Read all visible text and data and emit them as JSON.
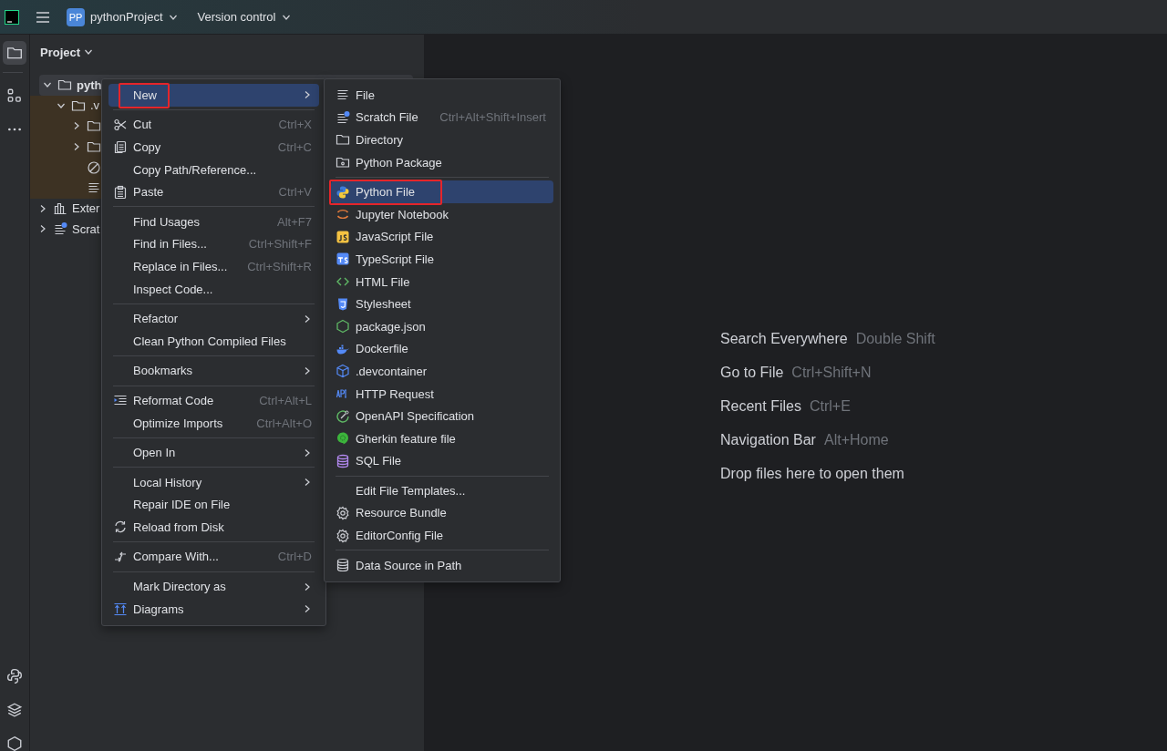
{
  "top_bar": {
    "project_badge": "PP",
    "project_name": "pythonProject",
    "vcs": "Version control"
  },
  "tool_strip": {
    "top": [
      {
        "selected": true
      },
      {
        "selected": false
      },
      {
        "selected": false
      }
    ],
    "bottom": [
      {
        "selected": false
      },
      {
        "selected": false
      },
      {
        "selected": false
      }
    ]
  },
  "project_panel": {
    "title": "Project",
    "tree": [
      {
        "kind": "folder",
        "label": "pyth",
        "expanded": true,
        "selected": true,
        "excluded": false,
        "children": [
          {
            "kind": "folder",
            "label": ".v",
            "expanded": true,
            "selected": false,
            "excluded": true,
            "children": [
              {
                "kind": "folder",
                "expanded": false,
                "selected": false,
                "excluded": true
              },
              {
                "kind": "folder",
                "expanded": false,
                "selected": false,
                "excluded": true
              },
              {
                "kind": "ignored",
                "selected": false,
                "excluded": true
              },
              {
                "kind": "text",
                "selected": false,
                "excluded": true
              }
            ]
          }
        ]
      },
      {
        "kind": "library",
        "label": "Exter",
        "expanded": false,
        "selected": false,
        "excluded": false
      },
      {
        "kind": "scratch",
        "label": "Scrat",
        "expanded": false,
        "selected": false,
        "excluded": false
      }
    ]
  },
  "context_menu": {
    "items": [
      {
        "kind": "item",
        "label": "New",
        "submenu": true,
        "selected": true,
        "annotated": true
      },
      {
        "kind": "separator"
      },
      {
        "kind": "item",
        "label": "Cut",
        "shortcut": "Ctrl+X",
        "selected": false,
        "annotated": false
      },
      {
        "kind": "item",
        "label": "Copy",
        "shortcut": "Ctrl+C",
        "selected": false,
        "annotated": false
      },
      {
        "kind": "item",
        "label": "Copy Path/Reference...",
        "selected": false,
        "annotated": false
      },
      {
        "kind": "item",
        "label": "Paste",
        "shortcut": "Ctrl+V",
        "selected": false,
        "annotated": false
      },
      {
        "kind": "separator"
      },
      {
        "kind": "item",
        "label": "Find Usages",
        "shortcut": "Alt+F7",
        "selected": false,
        "annotated": false
      },
      {
        "kind": "item",
        "label": "Find in Files...",
        "shortcut": "Ctrl+Shift+F",
        "selected": false,
        "annotated": false
      },
      {
        "kind": "item",
        "label": "Replace in Files...",
        "shortcut": "Ctrl+Shift+R",
        "selected": false,
        "annotated": false
      },
      {
        "kind": "item",
        "label": "Inspect Code...",
        "selected": false,
        "annotated": false
      },
      {
        "kind": "separator"
      },
      {
        "kind": "item",
        "label": "Refactor",
        "submenu": true,
        "selected": false,
        "annotated": false
      },
      {
        "kind": "item",
        "label": "Clean Python Compiled Files",
        "selected": false,
        "annotated": false
      },
      {
        "kind": "separator"
      },
      {
        "kind": "item",
        "label": "Bookmarks",
        "submenu": true,
        "selected": false,
        "annotated": false
      },
      {
        "kind": "separator"
      },
      {
        "kind": "item",
        "label": "Reformat Code",
        "shortcut": "Ctrl+Alt+L",
        "selected": false,
        "annotated": false
      },
      {
        "kind": "item",
        "label": "Optimize Imports",
        "shortcut": "Ctrl+Alt+O",
        "selected": false,
        "annotated": false
      },
      {
        "kind": "separator"
      },
      {
        "kind": "item",
        "label": "Open In",
        "submenu": true,
        "selected": false,
        "annotated": false
      },
      {
        "kind": "separator"
      },
      {
        "kind": "item",
        "label": "Local History",
        "submenu": true,
        "selected": false,
        "annotated": false
      },
      {
        "kind": "item",
        "label": "Repair IDE on File",
        "selected": false,
        "annotated": false
      },
      {
        "kind": "item",
        "label": "Reload from Disk",
        "selected": false,
        "annotated": false
      },
      {
        "kind": "separator"
      },
      {
        "kind": "item",
        "label": "Compare With...",
        "shortcut": "Ctrl+D",
        "selected": false,
        "annotated": false
      },
      {
        "kind": "separator"
      },
      {
        "kind": "item",
        "label": "Mark Directory as",
        "submenu": true,
        "selected": false,
        "annotated": false
      },
      {
        "kind": "item",
        "label": "Diagrams",
        "submenu": true,
        "selected": false,
        "annotated": false
      }
    ]
  },
  "new_submenu": {
    "items": [
      {
        "kind": "item",
        "label": "File",
        "selected": false,
        "annotated": false
      },
      {
        "kind": "item",
        "label": "Scratch File",
        "shortcut": "Ctrl+Alt+Shift+Insert",
        "selected": false,
        "annotated": false
      },
      {
        "kind": "item",
        "label": "Directory",
        "selected": false,
        "annotated": false
      },
      {
        "kind": "item",
        "label": "Python Package",
        "selected": false,
        "annotated": false
      },
      {
        "kind": "separator"
      },
      {
        "kind": "item",
        "label": "Python File",
        "selected": true,
        "annotated": true
      },
      {
        "kind": "item",
        "label": "Jupyter Notebook",
        "selected": false,
        "annotated": false
      },
      {
        "kind": "item",
        "label": "JavaScript File",
        "selected": false,
        "annotated": false
      },
      {
        "kind": "item",
        "label": "TypeScript File",
        "selected": false,
        "annotated": false
      },
      {
        "kind": "item",
        "label": "HTML File",
        "selected": false,
        "annotated": false
      },
      {
        "kind": "item",
        "label": "Stylesheet",
        "selected": false,
        "annotated": false
      },
      {
        "kind": "item",
        "label": "package.json",
        "selected": false,
        "annotated": false
      },
      {
        "kind": "item",
        "label": "Dockerfile",
        "selected": false,
        "annotated": false
      },
      {
        "kind": "item",
        "label": ".devcontainer",
        "selected": false,
        "annotated": false
      },
      {
        "kind": "item",
        "label": "HTTP Request",
        "selected": false,
        "annotated": false
      },
      {
        "kind": "item",
        "label": "OpenAPI Specification",
        "selected": false,
        "annotated": false
      },
      {
        "kind": "item",
        "label": "Gherkin feature file",
        "selected": false,
        "annotated": false
      },
      {
        "kind": "item",
        "label": "SQL File",
        "selected": false,
        "annotated": false
      },
      {
        "kind": "separator"
      },
      {
        "kind": "item",
        "label": "Edit File Templates...",
        "selected": false,
        "annotated": false
      },
      {
        "kind": "item",
        "label": "Resource Bundle",
        "selected": false,
        "annotated": false
      },
      {
        "kind": "item",
        "label": "EditorConfig File",
        "selected": false,
        "annotated": false
      },
      {
        "kind": "separator"
      },
      {
        "kind": "item",
        "label": "Data Source in Path",
        "selected": false,
        "annotated": false
      }
    ]
  },
  "editor_hints": {
    "items": [
      {
        "label": "Search Everywhere",
        "shortcut": "Double Shift"
      },
      {
        "label": "Go to File",
        "shortcut": "Ctrl+Shift+N"
      },
      {
        "label": "Recent Files",
        "shortcut": "Ctrl+E"
      },
      {
        "label": "Navigation Bar",
        "shortcut": "Alt+Home"
      },
      {
        "label": "Drop files here to open them"
      }
    ]
  }
}
